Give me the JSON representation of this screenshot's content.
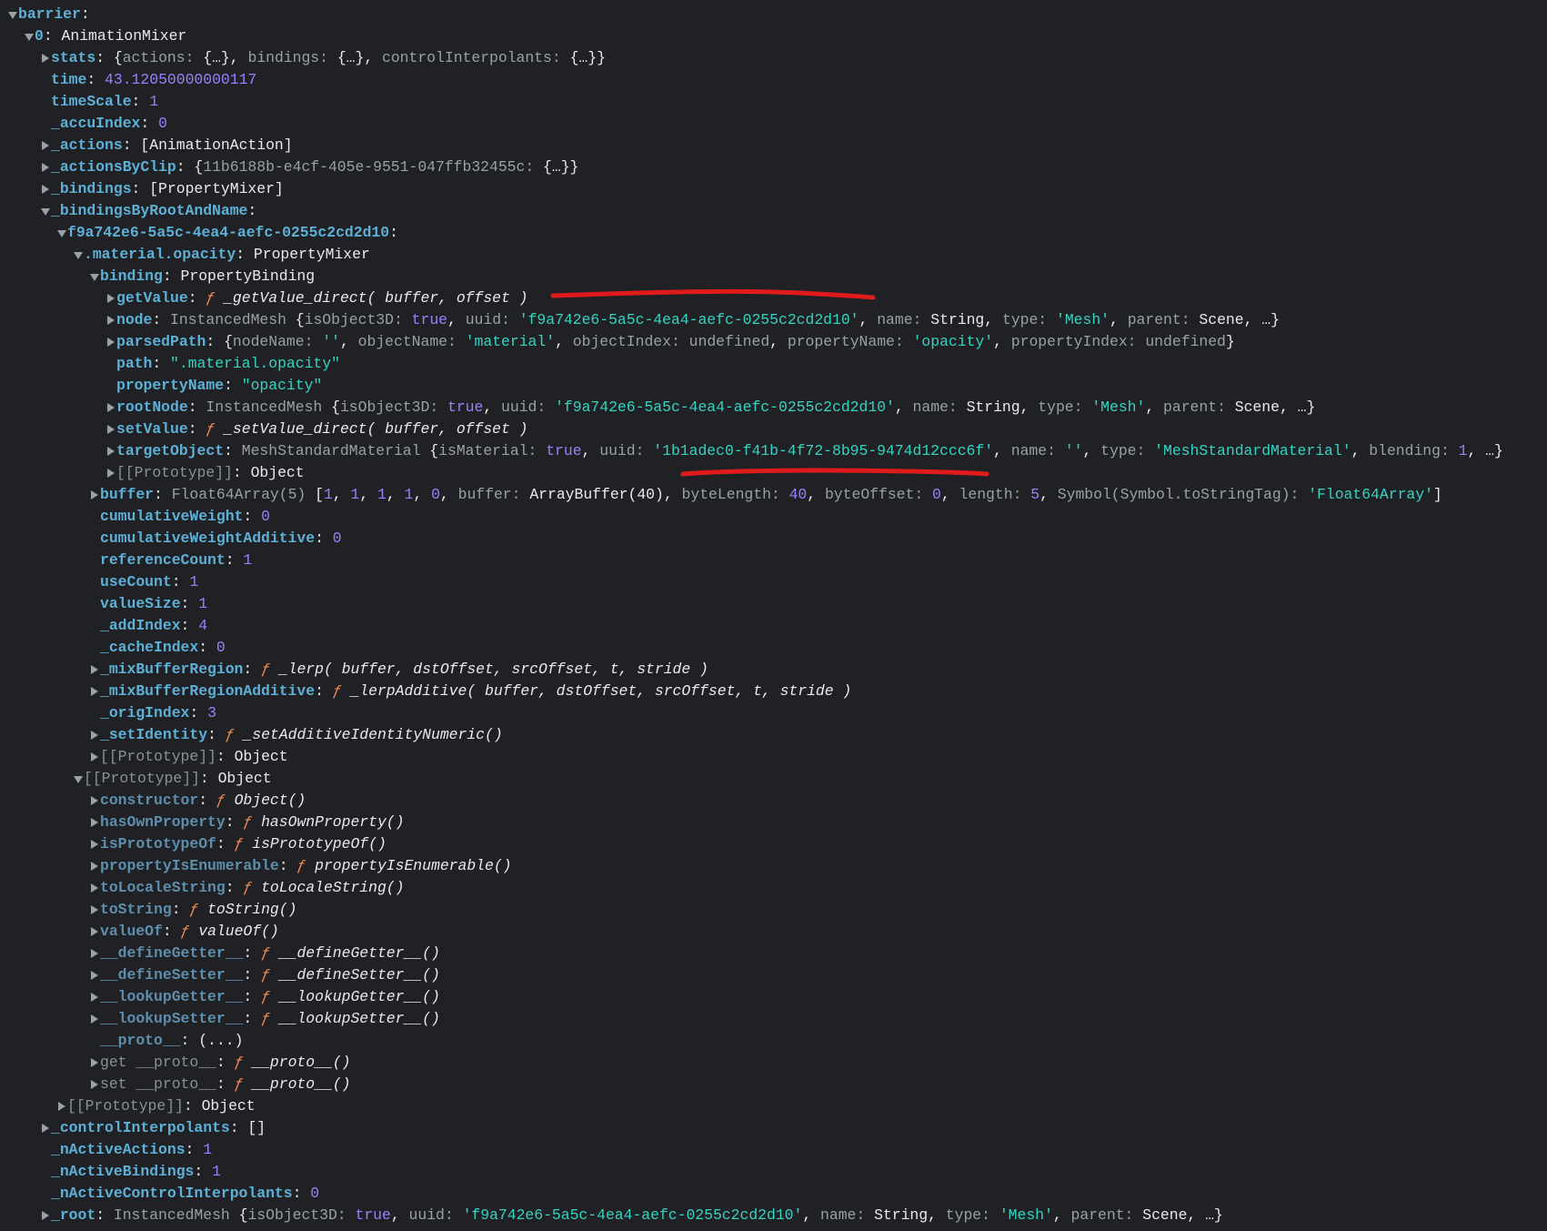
{
  "colors": {
    "background": "#202124",
    "key": "#5db0d7",
    "number": "#9980ff",
    "string": "#35d3c2",
    "function": "#f28b54",
    "annotation": "#e01b1b"
  },
  "rows": [
    {
      "lv": 0,
      "tg": "e",
      "k": "barrier",
      "kc": "k",
      "v": []
    },
    {
      "lv": 1,
      "tg": "e",
      "k": "0",
      "kc": "k",
      "v": [
        [
          "AnimationMixer",
          "w"
        ]
      ]
    },
    {
      "lv": 2,
      "tg": "c",
      "k": "stats",
      "kc": "k",
      "v": [
        [
          "{",
          "w"
        ],
        [
          "actions: ",
          "g"
        ],
        [
          "{…}, ",
          "w"
        ],
        [
          "bindings: ",
          "g"
        ],
        [
          "{…}, ",
          "w"
        ],
        [
          "controlInterpolants: ",
          "g"
        ],
        [
          "{…}}",
          "w"
        ]
      ]
    },
    {
      "lv": 2,
      "tg": "n",
      "k": "time",
      "kc": "k",
      "v": [
        [
          "43.12050000000117",
          "n"
        ]
      ]
    },
    {
      "lv": 2,
      "tg": "n",
      "k": "timeScale",
      "kc": "k",
      "v": [
        [
          "1",
          "n"
        ]
      ]
    },
    {
      "lv": 2,
      "tg": "n",
      "k": "_accuIndex",
      "kc": "k",
      "v": [
        [
          "0",
          "n"
        ]
      ]
    },
    {
      "lv": 2,
      "tg": "c",
      "k": "_actions",
      "kc": "k",
      "v": [
        [
          "[AnimationAction]",
          "w"
        ]
      ]
    },
    {
      "lv": 2,
      "tg": "c",
      "k": "_actionsByClip",
      "kc": "k",
      "v": [
        [
          "{",
          "w"
        ],
        [
          "11b6188b-e4cf-405e-9551-047ffb32455c: ",
          "g"
        ],
        [
          "{…}}",
          "w"
        ]
      ]
    },
    {
      "lv": 2,
      "tg": "c",
      "k": "_bindings",
      "kc": "k",
      "v": [
        [
          "[PropertyMixer]",
          "w"
        ]
      ]
    },
    {
      "lv": 2,
      "tg": "e",
      "k": "_bindingsByRootAndName",
      "kc": "k",
      "v": []
    },
    {
      "lv": 3,
      "tg": "e",
      "k": "f9a742e6-5a5c-4ea4-aefc-0255c2cd2d10",
      "kc": "k",
      "v": []
    },
    {
      "lv": 4,
      "tg": "e",
      "k": ".material.opacity",
      "kc": "k",
      "v": [
        [
          "PropertyMixer",
          "w"
        ]
      ]
    },
    {
      "lv": 5,
      "tg": "e",
      "k": "binding",
      "kc": "k",
      "v": [
        [
          "PropertyBinding",
          "w"
        ]
      ]
    },
    {
      "lv": 6,
      "tg": "c",
      "k": "getValue",
      "kc": "k",
      "v": [
        [
          "ƒ ",
          "f"
        ],
        [
          "_getValue_direct( buffer, offset )",
          "i"
        ]
      ]
    },
    {
      "lv": 6,
      "tg": "c",
      "k": "node",
      "kc": "k",
      "v": [
        [
          "InstancedMesh ",
          "g"
        ],
        [
          "{",
          "w"
        ],
        [
          "isObject3D: ",
          "g"
        ],
        [
          "true",
          "n"
        ],
        [
          ", ",
          "w"
        ],
        [
          "uuid: ",
          "g"
        ],
        [
          "'f9a742e6-5a5c-4ea4-aefc-0255c2cd2d10'",
          "s"
        ],
        [
          ", ",
          "w"
        ],
        [
          "name: ",
          "g"
        ],
        [
          "String",
          "w"
        ],
        [
          ", ",
          "w"
        ],
        [
          "type: ",
          "g"
        ],
        [
          "'Mesh'",
          "s"
        ],
        [
          ", ",
          "w"
        ],
        [
          "parent: ",
          "g"
        ],
        [
          "Scene",
          "w"
        ],
        [
          ", …}",
          "w"
        ]
      ]
    },
    {
      "lv": 6,
      "tg": "c",
      "k": "parsedPath",
      "kc": "k",
      "v": [
        [
          "{",
          "w"
        ],
        [
          "nodeName: ",
          "g"
        ],
        [
          "''",
          "s"
        ],
        [
          ", ",
          "w"
        ],
        [
          "objectName: ",
          "g"
        ],
        [
          "'material'",
          "s"
        ],
        [
          ", ",
          "w"
        ],
        [
          "objectIndex: ",
          "g"
        ],
        [
          "undefined",
          "g"
        ],
        [
          ", ",
          "w"
        ],
        [
          "propertyName: ",
          "g"
        ],
        [
          "'opacity'",
          "s"
        ],
        [
          ", ",
          "w"
        ],
        [
          "propertyIndex: ",
          "g"
        ],
        [
          "undefined",
          "g"
        ],
        [
          "}",
          "w"
        ]
      ]
    },
    {
      "lv": 6,
      "tg": "n",
      "k": "path",
      "kc": "k",
      "v": [
        [
          "\".material.opacity\"",
          "s"
        ]
      ]
    },
    {
      "lv": 6,
      "tg": "n",
      "k": "propertyName",
      "kc": "k",
      "v": [
        [
          "\"opacity\"",
          "s"
        ]
      ]
    },
    {
      "lv": 6,
      "tg": "c",
      "k": "rootNode",
      "kc": "k",
      "v": [
        [
          "InstancedMesh ",
          "g"
        ],
        [
          "{",
          "w"
        ],
        [
          "isObject3D: ",
          "g"
        ],
        [
          "true",
          "n"
        ],
        [
          ", ",
          "w"
        ],
        [
          "uuid: ",
          "g"
        ],
        [
          "'f9a742e6-5a5c-4ea4-aefc-0255c2cd2d10'",
          "s"
        ],
        [
          ", ",
          "w"
        ],
        [
          "name: ",
          "g"
        ],
        [
          "String",
          "w"
        ],
        [
          ", ",
          "w"
        ],
        [
          "type: ",
          "g"
        ],
        [
          "'Mesh'",
          "s"
        ],
        [
          ", ",
          "w"
        ],
        [
          "parent: ",
          "g"
        ],
        [
          "Scene",
          "w"
        ],
        [
          ", …}",
          "w"
        ]
      ]
    },
    {
      "lv": 6,
      "tg": "c",
      "k": "setValue",
      "kc": "k",
      "v": [
        [
          "ƒ ",
          "f"
        ],
        [
          "_setValue_direct( buffer, offset )",
          "i"
        ]
      ]
    },
    {
      "lv": 6,
      "tg": "c",
      "k": "targetObject",
      "kc": "k",
      "v": [
        [
          "MeshStandardMaterial ",
          "g"
        ],
        [
          "{",
          "w"
        ],
        [
          "isMaterial: ",
          "g"
        ],
        [
          "true",
          "n"
        ],
        [
          ", ",
          "w"
        ],
        [
          "uuid: ",
          "g"
        ],
        [
          "'1b1adec0-f41b-4f72-8b95-9474d12ccc6f'",
          "s"
        ],
        [
          ", ",
          "w"
        ],
        [
          "name: ",
          "g"
        ],
        [
          "''",
          "s"
        ],
        [
          ", ",
          "w"
        ],
        [
          "type: ",
          "g"
        ],
        [
          "'MeshStandardMaterial'",
          "s"
        ],
        [
          ", ",
          "w"
        ],
        [
          "blending: ",
          "g"
        ],
        [
          "1",
          "n"
        ],
        [
          ", …}",
          "w"
        ]
      ]
    },
    {
      "lv": 6,
      "tg": "c",
      "k": "[[Prototype]]",
      "kc": "kg",
      "v": [
        [
          "Object",
          "w"
        ]
      ]
    },
    {
      "lv": 5,
      "tg": "c",
      "k": "buffer",
      "kc": "k",
      "v": [
        [
          "Float64Array(5) ",
          "g"
        ],
        [
          "[",
          "w"
        ],
        [
          "1",
          "n"
        ],
        [
          ", ",
          "w"
        ],
        [
          "1",
          "n"
        ],
        [
          ", ",
          "w"
        ],
        [
          "1",
          "n"
        ],
        [
          ", ",
          "w"
        ],
        [
          "1",
          "n"
        ],
        [
          ", ",
          "w"
        ],
        [
          "0",
          "n"
        ],
        [
          ", ",
          "w"
        ],
        [
          "buffer: ",
          "g"
        ],
        [
          "ArrayBuffer(40)",
          "w"
        ],
        [
          ", ",
          "w"
        ],
        [
          "byteLength: ",
          "g"
        ],
        [
          "40",
          "n"
        ],
        [
          ", ",
          "w"
        ],
        [
          "byteOffset: ",
          "g"
        ],
        [
          "0",
          "n"
        ],
        [
          ", ",
          "w"
        ],
        [
          "length: ",
          "g"
        ],
        [
          "5",
          "n"
        ],
        [
          ", ",
          "w"
        ],
        [
          "Symbol(Symbol.toStringTag): ",
          "g"
        ],
        [
          "'Float64Array'",
          "s"
        ],
        [
          "]",
          "w"
        ]
      ]
    },
    {
      "lv": 5,
      "tg": "n",
      "k": "cumulativeWeight",
      "kc": "k",
      "v": [
        [
          "0",
          "n"
        ]
      ]
    },
    {
      "lv": 5,
      "tg": "n",
      "k": "cumulativeWeightAdditive",
      "kc": "k",
      "v": [
        [
          "0",
          "n"
        ]
      ]
    },
    {
      "lv": 5,
      "tg": "n",
      "k": "referenceCount",
      "kc": "k",
      "v": [
        [
          "1",
          "n"
        ]
      ]
    },
    {
      "lv": 5,
      "tg": "n",
      "k": "useCount",
      "kc": "k",
      "v": [
        [
          "1",
          "n"
        ]
      ]
    },
    {
      "lv": 5,
      "tg": "n",
      "k": "valueSize",
      "kc": "k",
      "v": [
        [
          "1",
          "n"
        ]
      ]
    },
    {
      "lv": 5,
      "tg": "n",
      "k": "_addIndex",
      "kc": "k",
      "v": [
        [
          "4",
          "n"
        ]
      ]
    },
    {
      "lv": 5,
      "tg": "n",
      "k": "_cacheIndex",
      "kc": "k",
      "v": [
        [
          "0",
          "n"
        ]
      ]
    },
    {
      "lv": 5,
      "tg": "c",
      "k": "_mixBufferRegion",
      "kc": "k",
      "v": [
        [
          "ƒ ",
          "f"
        ],
        [
          "_lerp( buffer, dstOffset, srcOffset, t, stride )",
          "i"
        ]
      ]
    },
    {
      "lv": 5,
      "tg": "c",
      "k": "_mixBufferRegionAdditive",
      "kc": "k",
      "v": [
        [
          "ƒ ",
          "f"
        ],
        [
          "_lerpAdditive( buffer, dstOffset, srcOffset, t, stride )",
          "i"
        ]
      ]
    },
    {
      "lv": 5,
      "tg": "n",
      "k": "_origIndex",
      "kc": "k",
      "v": [
        [
          "3",
          "n"
        ]
      ]
    },
    {
      "lv": 5,
      "tg": "c",
      "k": "_setIdentity",
      "kc": "k",
      "v": [
        [
          "ƒ ",
          "f"
        ],
        [
          "_setAdditiveIdentityNumeric()",
          "i"
        ]
      ]
    },
    {
      "lv": 5,
      "tg": "c",
      "k": "[[Prototype]]",
      "kc": "kg",
      "v": [
        [
          "Object",
          "w"
        ]
      ]
    },
    {
      "lv": 4,
      "tg": "e",
      "k": "[[Prototype]]",
      "kc": "kg",
      "v": [
        [
          "Object",
          "w"
        ]
      ]
    },
    {
      "lv": 5,
      "tg": "c",
      "k": "constructor",
      "kc": "kd",
      "v": [
        [
          "ƒ ",
          "f"
        ],
        [
          "Object()",
          "i"
        ]
      ]
    },
    {
      "lv": 5,
      "tg": "c",
      "k": "hasOwnProperty",
      "kc": "kd",
      "v": [
        [
          "ƒ ",
          "f"
        ],
        [
          "hasOwnProperty()",
          "i"
        ]
      ]
    },
    {
      "lv": 5,
      "tg": "c",
      "k": "isPrototypeOf",
      "kc": "kd",
      "v": [
        [
          "ƒ ",
          "f"
        ],
        [
          "isPrototypeOf()",
          "i"
        ]
      ]
    },
    {
      "lv": 5,
      "tg": "c",
      "k": "propertyIsEnumerable",
      "kc": "kd",
      "v": [
        [
          "ƒ ",
          "f"
        ],
        [
          "propertyIsEnumerable()",
          "i"
        ]
      ]
    },
    {
      "lv": 5,
      "tg": "c",
      "k": "toLocaleString",
      "kc": "kd",
      "v": [
        [
          "ƒ ",
          "f"
        ],
        [
          "toLocaleString()",
          "i"
        ]
      ]
    },
    {
      "lv": 5,
      "tg": "c",
      "k": "toString",
      "kc": "kd",
      "v": [
        [
          "ƒ ",
          "f"
        ],
        [
          "toString()",
          "i"
        ]
      ]
    },
    {
      "lv": 5,
      "tg": "c",
      "k": "valueOf",
      "kc": "kd",
      "v": [
        [
          "ƒ ",
          "f"
        ],
        [
          "valueOf()",
          "i"
        ]
      ]
    },
    {
      "lv": 5,
      "tg": "c",
      "k": "__defineGetter__",
      "kc": "kd",
      "v": [
        [
          "ƒ ",
          "f"
        ],
        [
          "__defineGetter__()",
          "i"
        ]
      ]
    },
    {
      "lv": 5,
      "tg": "c",
      "k": "__defineSetter__",
      "kc": "kd",
      "v": [
        [
          "ƒ ",
          "f"
        ],
        [
          "__defineSetter__()",
          "i"
        ]
      ]
    },
    {
      "lv": 5,
      "tg": "c",
      "k": "__lookupGetter__",
      "kc": "kd",
      "v": [
        [
          "ƒ ",
          "f"
        ],
        [
          "__lookupGetter__()",
          "i"
        ]
      ]
    },
    {
      "lv": 5,
      "tg": "c",
      "k": "__lookupSetter__",
      "kc": "kd",
      "v": [
        [
          "ƒ ",
          "f"
        ],
        [
          "__lookupSetter__()",
          "i"
        ]
      ]
    },
    {
      "lv": 5,
      "tg": "n",
      "k": "__proto__",
      "kc": "kd",
      "v": [
        [
          "(...)",
          "w"
        ]
      ]
    },
    {
      "lv": 5,
      "tg": "c",
      "k": "get __proto__",
      "kc": "kg",
      "v": [
        [
          "ƒ ",
          "f"
        ],
        [
          "__proto__()",
          "i"
        ]
      ]
    },
    {
      "lv": 5,
      "tg": "c",
      "k": "set __proto__",
      "kc": "kg",
      "v": [
        [
          "ƒ ",
          "f"
        ],
        [
          "__proto__()",
          "i"
        ]
      ]
    },
    {
      "lv": 3,
      "tg": "c",
      "k": "[[Prototype]]",
      "kc": "kg",
      "v": [
        [
          "Object",
          "w"
        ]
      ]
    },
    {
      "lv": 2,
      "tg": "c",
      "k": "_controlInterpolants",
      "kc": "k",
      "v": [
        [
          "[]",
          "w"
        ]
      ]
    },
    {
      "lv": 2,
      "tg": "n",
      "k": "_nActiveActions",
      "kc": "k",
      "v": [
        [
          "1",
          "n"
        ]
      ]
    },
    {
      "lv": 2,
      "tg": "n",
      "k": "_nActiveBindings",
      "kc": "k",
      "v": [
        [
          "1",
          "n"
        ]
      ]
    },
    {
      "lv": 2,
      "tg": "n",
      "k": "_nActiveControlInterpolants",
      "kc": "k",
      "v": [
        [
          "0",
          "n"
        ]
      ]
    },
    {
      "lv": 2,
      "tg": "c",
      "k": "_root",
      "kc": "k",
      "v": [
        [
          "InstancedMesh ",
          "g"
        ],
        [
          "{",
          "w"
        ],
        [
          "isObject3D: ",
          "g"
        ],
        [
          "true",
          "n"
        ],
        [
          ", ",
          "w"
        ],
        [
          "uuid: ",
          "g"
        ],
        [
          "'f9a742e6-5a5c-4ea4-aefc-0255c2cd2d10'",
          "s"
        ],
        [
          ", ",
          "w"
        ],
        [
          "name: ",
          "g"
        ],
        [
          "String",
          "w"
        ],
        [
          ", ",
          "w"
        ],
        [
          "type: ",
          "g"
        ],
        [
          "'Mesh'",
          "s"
        ],
        [
          ", ",
          "w"
        ],
        [
          "parent: ",
          "g"
        ],
        [
          "Scene",
          "w"
        ],
        [
          ", …}",
          "w"
        ]
      ]
    }
  ]
}
